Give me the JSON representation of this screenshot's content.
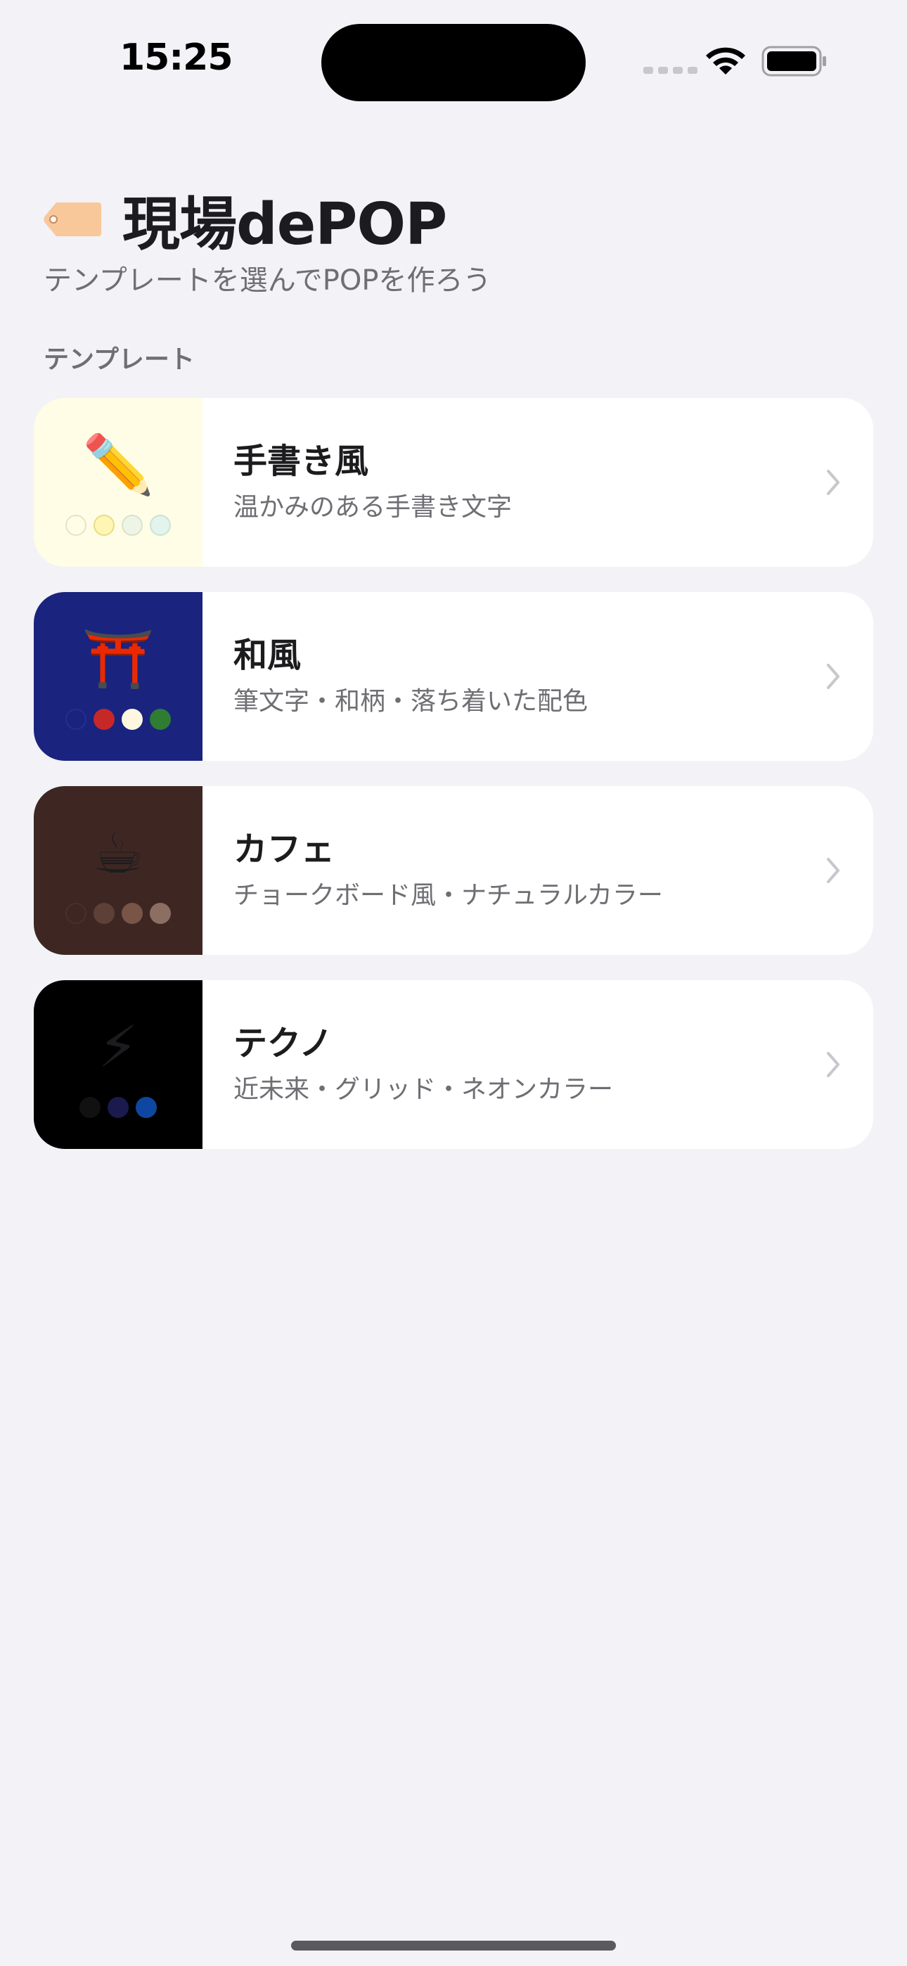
{
  "status_bar": {
    "time": "15:25",
    "icons": [
      "cellular-signal-icon",
      "wifi-icon",
      "battery-icon"
    ]
  },
  "header": {
    "icon": "price-tag-icon",
    "title": "現場dePOP",
    "subtitle": "テンプレートを選んでPOPを作ろう"
  },
  "section": {
    "title": "テンプレート"
  },
  "templates": [
    {
      "title": "手書き風",
      "description": "温かみのある手書き文字",
      "emoji": "✏️",
      "icon": "pencil-icon",
      "thumb_bg": "#fffde6",
      "swatches": [
        "#fffde6",
        "#fff6b3",
        "#eef5e6",
        "#e3f4ec"
      ]
    },
    {
      "title": "和風",
      "description": "筆文字・和柄・落ち着いた配色",
      "emoji": "⛩️",
      "icon": "torii-gate-icon",
      "thumb_bg": "#1a237e",
      "swatches": [
        "#1a237e",
        "#c62828",
        "#fff8e1",
        "#2e7d32"
      ]
    },
    {
      "title": "カフェ",
      "description": "チョークボード風・ナチュラルカラー",
      "emoji": "☕",
      "icon": "coffee-cup-icon",
      "thumb_bg": "#3e2723",
      "swatches": [
        "#3e2723",
        "#5d4037",
        "#795548",
        "#8d6e63"
      ]
    },
    {
      "title": "テクノ",
      "description": "近未来・グリッド・ネオンカラー",
      "emoji": "⚡",
      "icon": "lightning-icon",
      "thumb_bg": "#000000",
      "swatches": [
        "#111111",
        "#1a1a4e",
        "#0d47a1"
      ]
    }
  ],
  "colors": {
    "background": "#f2f2f7",
    "card": "#ffffff",
    "primary_text": "#1c1c1e",
    "secondary_text": "#6e6e73",
    "chevron": "#c7c7cc",
    "tag": "#f8c89a"
  }
}
